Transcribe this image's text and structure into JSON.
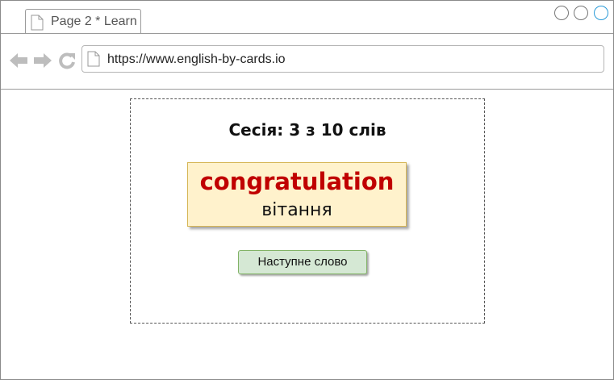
{
  "tab": {
    "label": "Page 2 * Learn",
    "icon": "document-icon"
  },
  "window_controls": [
    "minimize-icon",
    "maximize-icon",
    "close-icon"
  ],
  "nav": {
    "back_icon": "back-arrow-icon",
    "forward_icon": "forward-arrow-icon",
    "reload_icon": "reload-icon"
  },
  "address_bar": {
    "url": "https://www.english-by-cards.io",
    "icon": "document-icon"
  },
  "main": {
    "session_text": "Сесія: 3 з 10 слів",
    "card": {
      "word": "congratulation",
      "translation": "вітання"
    },
    "next_button_label": "Наступне слово"
  },
  "colors": {
    "card_bg": "#fff2cc",
    "card_border": "#d6b656",
    "word": "#c00000",
    "button_bg": "#d5e8d4",
    "button_border": "#82b366",
    "close_accent": "#2a9bd8"
  }
}
